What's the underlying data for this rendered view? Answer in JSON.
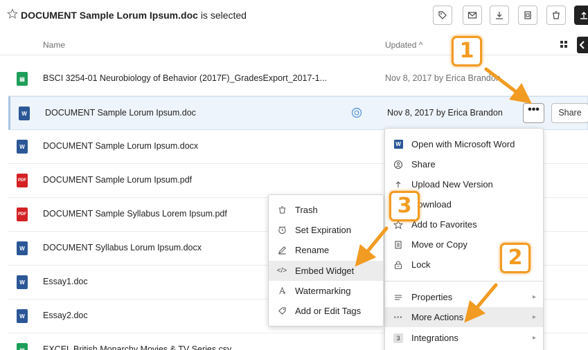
{
  "header": {
    "selected_file": "DOCUMENT Sample Lorum Ipsum.doc",
    "selected_suffix": "is selected"
  },
  "columns": {
    "name": "Name",
    "updated": "Updated ^"
  },
  "files": [
    {
      "name": "BSCI 3254-01 Neurobiology of Behavior (2017F)_GradesExport_2017-1...",
      "updated": "Nov 8, 2017 by Erica Brandon",
      "type": "excel"
    },
    {
      "name": "DOCUMENT Sample Lorum Ipsum.doc",
      "updated": "Nov 8, 2017 by Erica Brandon",
      "type": "word"
    },
    {
      "name": "DOCUMENT Sample Lorum Ipsum.docx",
      "updated": "",
      "type": "word"
    },
    {
      "name": "DOCUMENT Sample Lorum Ipsum.pdf",
      "updated": "",
      "type": "pdf"
    },
    {
      "name": "DOCUMENT Sample Syllabus Lorem Ipsum.pdf",
      "updated": "",
      "type": "pdf"
    },
    {
      "name": "DOCUMENT Syllabus Lorum Ipsum.docx",
      "updated": "",
      "type": "word"
    },
    {
      "name": "Essay1.doc",
      "updated": "",
      "type": "word"
    },
    {
      "name": "Essay2.doc",
      "updated": "",
      "type": "word"
    },
    {
      "name": "EXCEL British Monarchy Movies & TV Series.csv",
      "updated": "",
      "type": "excel"
    }
  ],
  "row_actions": {
    "more": "•••",
    "share": "Share"
  },
  "context_menu": {
    "items": [
      "Open with Microsoft Word",
      "Share",
      "Upload New Version",
      "Download",
      "Add to Favorites",
      "Move or Copy",
      "Lock"
    ],
    "lower_items": [
      "Properties",
      "More Actions",
      "Integrations"
    ],
    "integrations_count": "3"
  },
  "submenu": {
    "items": [
      "Trash",
      "Set Expiration",
      "Rename",
      "Embed Widget",
      "Watermarking",
      "Add or Edit Tags"
    ]
  },
  "callouts": [
    "1",
    "2",
    "3"
  ],
  "colors": {
    "callout": "#f29b22",
    "selected_row": "#eef4fb",
    "word": "#2b5797",
    "excel": "#1e9e5a",
    "pdf": "#d32124"
  }
}
